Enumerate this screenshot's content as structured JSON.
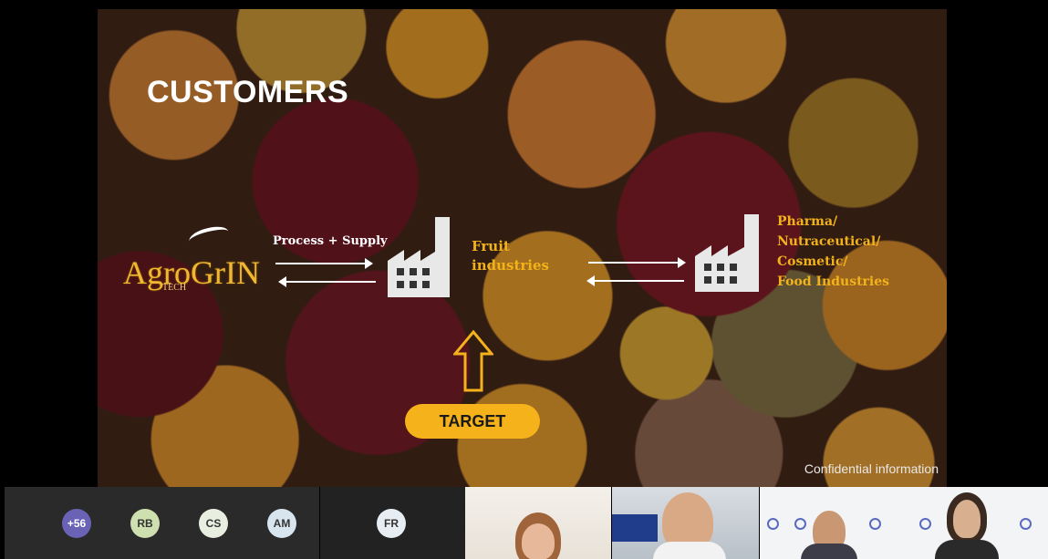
{
  "slide": {
    "title": "CUSTOMERS",
    "brand_name": "AgroGrIN",
    "brand_sub": "TECH",
    "process_label": "Process + Supply",
    "fruit_label_line1": "Fruit",
    "fruit_label_line2": "industries",
    "pharma_lines": [
      "Pharma/",
      "Nutraceutical/",
      "Cosmetic/",
      "Food Industries"
    ],
    "target_label": "TARGET",
    "footer": "Confidential information",
    "accent_color": "#f5b21a"
  },
  "participants": {
    "overflow_count": "+56",
    "initials": [
      "RB",
      "CS",
      "AM"
    ],
    "featured_initials": "FR",
    "avatar_colors": {
      "overflow": "#6a63b5",
      "rb": "#cfe0b0",
      "cs": "#e8efe0",
      "am": "#d8e4ee",
      "fr": "#e6eef4"
    },
    "video_tiles": [
      "participant-video-1",
      "participant-video-2",
      "participant-video-3"
    ]
  }
}
